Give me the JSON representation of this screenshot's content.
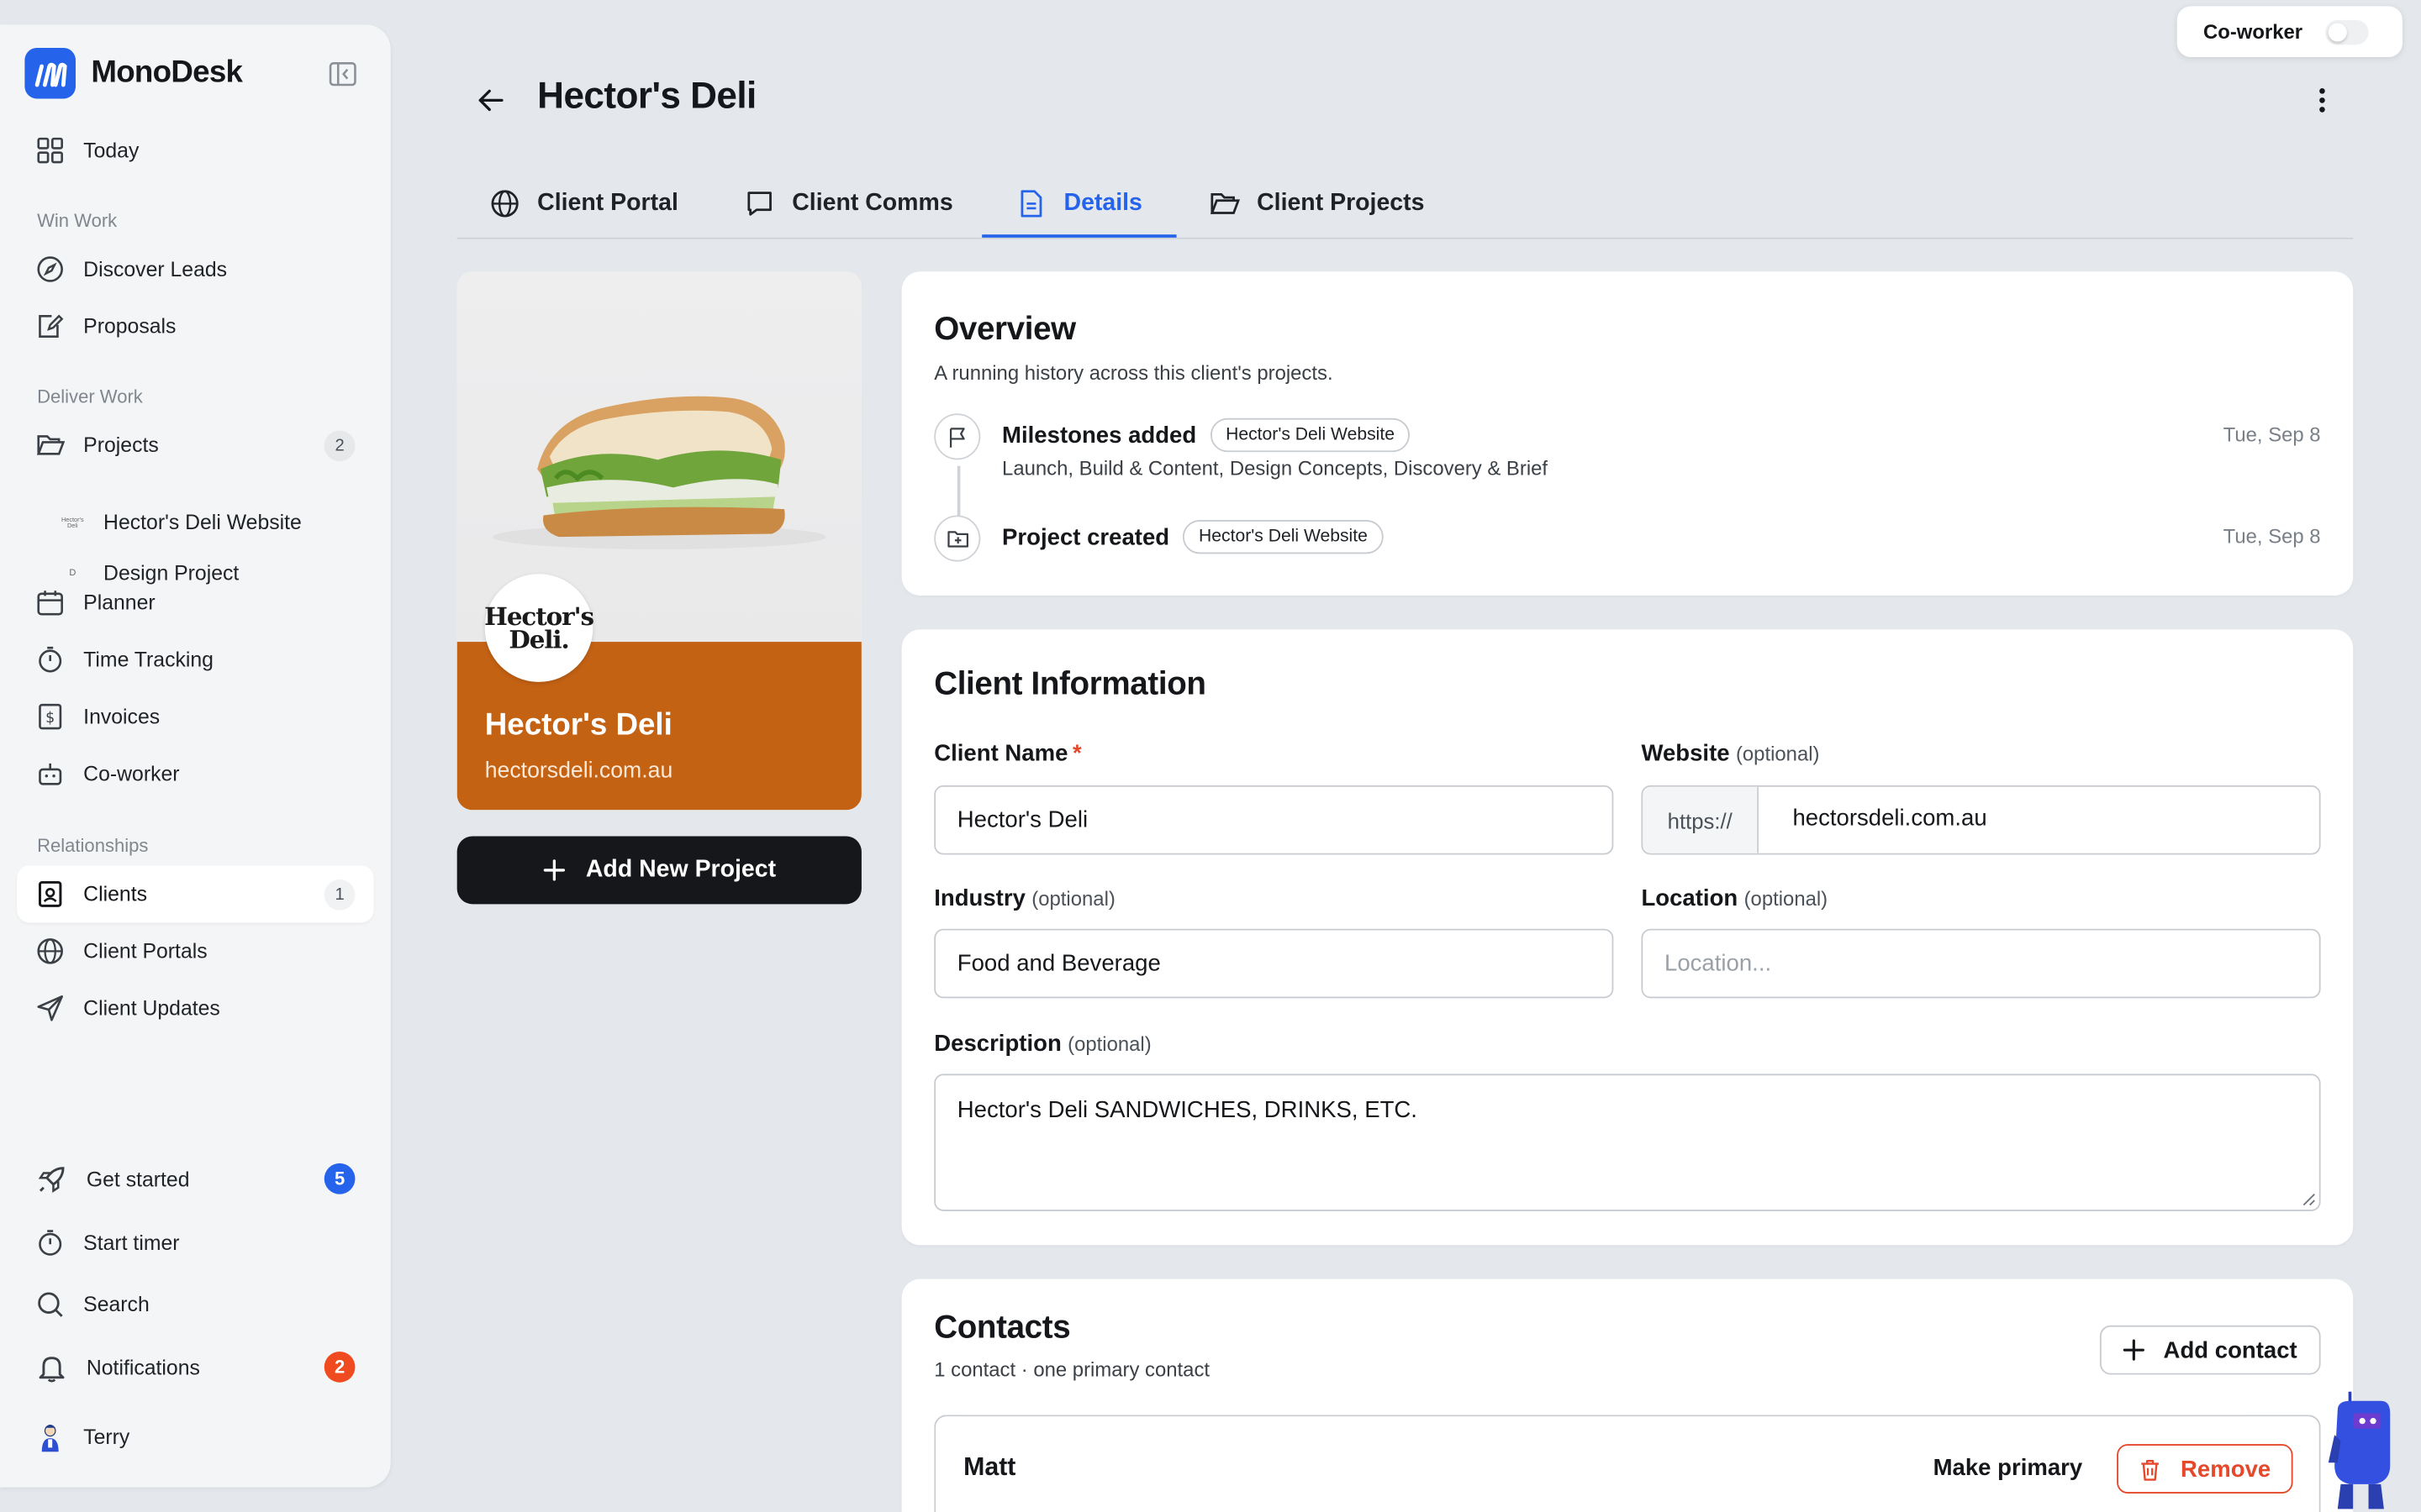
{
  "app": {
    "name": "MonoDesk"
  },
  "sidebar": {
    "today": "Today",
    "sections": {
      "win_work": "Win Work",
      "deliver_work": "Deliver Work",
      "relationships": "Relationships"
    },
    "discover_leads": "Discover Leads",
    "proposals": "Proposals",
    "projects": {
      "label": "Projects",
      "count": "2"
    },
    "sub_projects": [
      {
        "label": "Hector's Deli Website",
        "thumb": "Hector's Deli"
      },
      {
        "label": "Design Project",
        "thumb": "D"
      }
    ],
    "planner": "Planner",
    "time_tracking": "Time Tracking",
    "invoices": "Invoices",
    "coworker": "Co-worker",
    "clients": {
      "label": "Clients",
      "count": "1"
    },
    "client_portals": "Client Portals",
    "client_updates": "Client Updates",
    "get_started": {
      "label": "Get started",
      "count": "5"
    },
    "start_timer": "Start timer",
    "search": "Search",
    "notifications": {
      "label": "Notifications",
      "count": "2"
    },
    "user": "Terry"
  },
  "header": {
    "title": "Hector's Deli",
    "coworker_toggle": "Co-worker"
  },
  "tabs": [
    {
      "label": "Client Portal"
    },
    {
      "label": "Client Comms"
    },
    {
      "label": "Details"
    },
    {
      "label": "Client Projects"
    }
  ],
  "client_card": {
    "logo_line1": "Hector's",
    "logo_line2": "Deli.",
    "name": "Hector's Deli",
    "url": "hectorsdeli.com.au",
    "add_project": "Add New Project"
  },
  "overview": {
    "title": "Overview",
    "subtitle": "A running history across this client's projects.",
    "events": [
      {
        "title": "Milestones added",
        "chip": "Hector's Deli Website",
        "detail": "Launch, Build & Content, Design Concepts, Discovery & Brief",
        "date": "Tue, Sep 8"
      },
      {
        "title": "Project created",
        "chip": "Hector's Deli Website",
        "date": "Tue, Sep 8"
      }
    ]
  },
  "client_info": {
    "title": "Client Information",
    "optional": "(optional)",
    "required_mark": "*",
    "name_label": "Client Name",
    "name_value": "Hector's Deli",
    "website_label": "Website",
    "website_prefix": "https://",
    "website_value": "hectorsdeli.com.au",
    "industry_label": "Industry",
    "industry_value": "Food and Beverage",
    "location_label": "Location",
    "location_placeholder": "Location...",
    "description_label": "Description",
    "description_value": "Hector's Deli SANDWICHES, DRINKS, ETC."
  },
  "contacts": {
    "title": "Contacts",
    "summary": "1 contact · one primary contact",
    "add_contact": "Add contact",
    "items": [
      {
        "name": "Matt",
        "make_primary": "Make primary",
        "remove": "Remove"
      }
    ]
  },
  "colors": {
    "accent": "#2563eb",
    "brand_orange": "#c46214",
    "danger": "#e5482a",
    "background": "#e4e8ec"
  }
}
